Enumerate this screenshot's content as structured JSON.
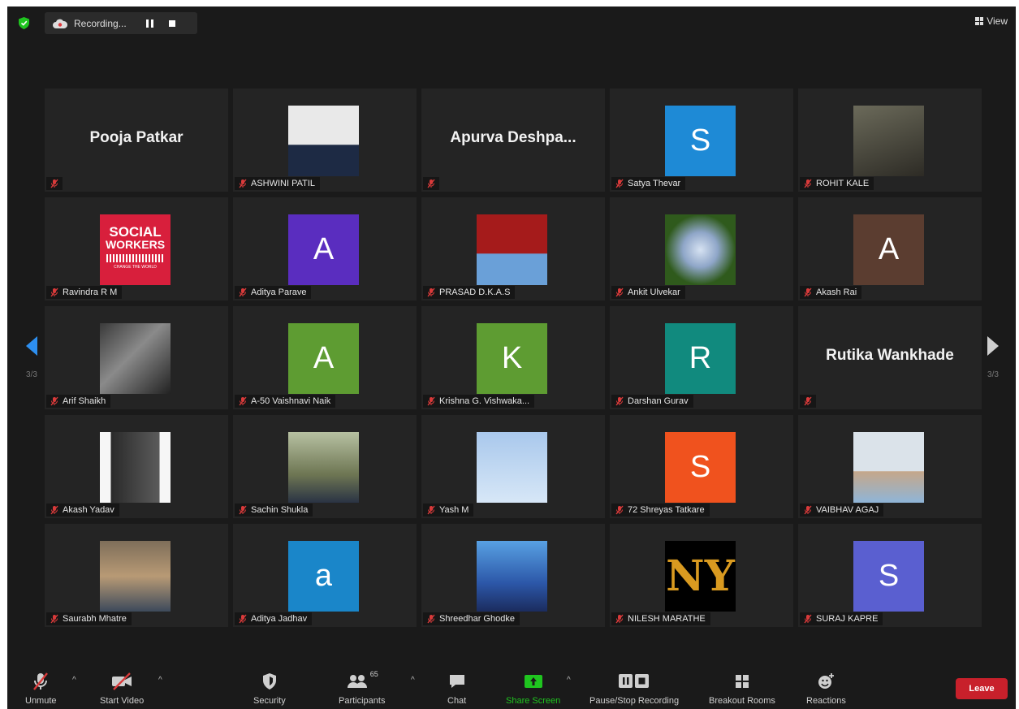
{
  "recording": {
    "label": "Recording..."
  },
  "view": {
    "label": "View"
  },
  "pager": {
    "left": "3/3",
    "right": "3/3"
  },
  "tiles": [
    {
      "name": "Pooja Patkar",
      "big": "Pooja Patkar"
    },
    {
      "name": "ASHWINI PATIL"
    },
    {
      "name": "Apurva Deshpa...",
      "big": "Apurva  Deshpa..."
    },
    {
      "name": "Satya Thevar",
      "letter": "S",
      "color": "#1e8ad6"
    },
    {
      "name": "ROHIT KALE"
    },
    {
      "name": "Ravindra R M",
      "logo": [
        "SOCIAL",
        "WORKERS",
        "CHANGE THE WORLD"
      ]
    },
    {
      "name": "Aditya Parave",
      "letter": "A",
      "color": "#5a2dbf"
    },
    {
      "name": "PRASAD D.K.A.S"
    },
    {
      "name": "Ankit Ulvekar"
    },
    {
      "name": "Akash Rai",
      "letter": "A",
      "color": "#5b3d30"
    },
    {
      "name": "Arif Shaikh"
    },
    {
      "name": "A-50 Vaishnavi Naik",
      "letter": "A",
      "color": "#5e9c32"
    },
    {
      "name": "Krishna G. Vishwaka...",
      "letter": "K",
      "color": "#5e9c32"
    },
    {
      "name": "Darshan Gurav",
      "letter": "R",
      "color": "#118a7e"
    },
    {
      "name": "Rutika Wankhade",
      "big": "Rutika Wankhade"
    },
    {
      "name": "Akash Yadav"
    },
    {
      "name": "Sachin Shukla"
    },
    {
      "name": "Yash M"
    },
    {
      "name": "72 Shreyas Tatkare",
      "letter": "S",
      "color": "#f0521e"
    },
    {
      "name": "VAIBHAV AGAJ"
    },
    {
      "name": "Saurabh Mhatre"
    },
    {
      "name": "Aditya Jadhav",
      "letter": "a",
      "color": "#1a86c9"
    },
    {
      "name": "Shreedhar Ghodke"
    },
    {
      "name": "NILESH MARATHE",
      "logo": [
        "NY"
      ]
    },
    {
      "name": "SURAJ KAPRE",
      "letter": "S",
      "color": "#5a5fd0"
    }
  ],
  "toolbar": {
    "unmute": "Unmute",
    "start_video": "Start Video",
    "security": "Security",
    "participants": "Participants",
    "participants_count": "65",
    "chat": "Chat",
    "share_screen": "Share Screen",
    "pause_stop_recording": "Pause/Stop Recording",
    "breakout_rooms": "Breakout Rooms",
    "reactions": "Reactions",
    "leave": "Leave"
  },
  "colors": {
    "share_green": "#1fc51f",
    "leave_red": "#c8202b",
    "muted_red": "#d93a3a"
  }
}
